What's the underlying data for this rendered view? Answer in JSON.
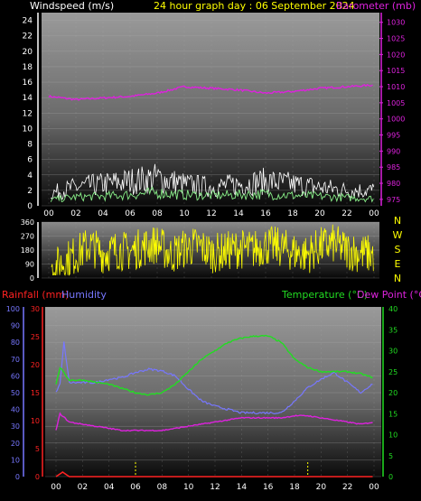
{
  "header": {
    "wind_label": "Windspeed (m/s)",
    "title": "24 hour graph day : 06 September 2024",
    "baro_label": "Barometer (mb)"
  },
  "colors": {
    "wind": "#ffffff",
    "gust": "#ffffff",
    "wind_avg": "#88ee88",
    "barometer": "#dd22dd",
    "direction": "#ffff00",
    "temperature": "#22dd22",
    "dewpoint": "#dd22dd",
    "humidity": "#7777ff",
    "rainfall": "#ff2222",
    "header_text": "#ffff00",
    "wind_axis": "#ffffff",
    "rain_axis": "#ff2222"
  },
  "chart_data": [
    {
      "type": "line",
      "name": "wind-barometer",
      "x_ticks": [
        "00",
        "02",
        "04",
        "06",
        "08",
        "10",
        "12",
        "14",
        "16",
        "18",
        "20",
        "22",
        "00"
      ],
      "y_left_ticks": [
        "0",
        "2",
        "4",
        "6",
        "8",
        "10",
        "12",
        "14",
        "16",
        "18",
        "20",
        "22",
        "24"
      ],
      "ylim_left": [
        0,
        25
      ],
      "y_right_ticks": [
        "975",
        "980",
        "985",
        "990",
        "995",
        "1000",
        "1005",
        "1010",
        "1015",
        "1020",
        "1025",
        "1030"
      ],
      "ylim_right": [
        973,
        1033
      ],
      "series": [
        {
          "axis": "right",
          "x": [
            0,
            2,
            4,
            6,
            8,
            10,
            12,
            14,
            16,
            18,
            20,
            22,
            24
          ],
          "values": [
            1007,
            1006,
            1006.5,
            1007,
            1008,
            1010,
            1009.5,
            1009,
            1008,
            1008.5,
            1009.5,
            1010,
            1010.5
          ]
        },
        {
          "axis": "left",
          "x": [
            0,
            2,
            4,
            6,
            8,
            10,
            12,
            14,
            16,
            18,
            20,
            22,
            24
          ],
          "values": [
            2,
            3,
            3.5,
            4,
            4.5,
            3.5,
            3,
            3.5,
            4,
            3.5,
            3,
            2.5,
            2.5
          ]
        },
        {
          "axis": "left",
          "x": [
            0,
            2,
            4,
            6,
            8,
            10,
            12,
            14,
            16,
            18,
            20,
            22,
            24
          ],
          "values": [
            0.8,
            1.2,
            1.3,
            1.5,
            1.8,
            1.5,
            1.4,
            1.5,
            1.6,
            1.4,
            1.3,
            1.1,
            1
          ]
        }
      ]
    },
    {
      "type": "scatter",
      "name": "wind-direction",
      "x_ticks": [
        "00",
        "02",
        "04",
        "06",
        "08",
        "10",
        "12",
        "14",
        "16",
        "18",
        "20",
        "22",
        "00"
      ],
      "y_ticks": [
        "0",
        "90",
        "180",
        "270",
        "360"
      ],
      "ylim": [
        0,
        360
      ],
      "compass": [
        "N",
        "W",
        "S",
        "E",
        "N"
      ],
      "series": [
        {
          "x": [
            0,
            1,
            2,
            3,
            4,
            5,
            6,
            7,
            8,
            9,
            10,
            11,
            12,
            13,
            14,
            15,
            16,
            17,
            18,
            19,
            20,
            21,
            22,
            23,
            24
          ],
          "values": [
            40,
            100,
            150,
            210,
            160,
            180,
            170,
            200,
            220,
            150,
            190,
            210,
            160,
            170,
            190,
            180,
            210,
            200,
            170,
            150,
            200,
            220,
            180,
            160,
            150
          ]
        }
      ]
    },
    {
      "type": "line",
      "name": "temp-humidity-rain",
      "x_ticks": [
        "00",
        "02",
        "04",
        "06",
        "08",
        "10",
        "12",
        "14",
        "16",
        "18",
        "20",
        "22",
        "00"
      ],
      "y_humidity_ticks": [
        "0",
        "10",
        "20",
        "30",
        "40",
        "50",
        "60",
        "70",
        "80",
        "90",
        "100"
      ],
      "ylim_humidity": [
        0,
        100
      ],
      "y_rain_ticks": [
        "0",
        "5",
        "10",
        "15",
        "20",
        "25",
        "30"
      ],
      "ylim_rain": [
        0,
        30
      ],
      "y_temp_ticks": [
        "0",
        "5",
        "10",
        "15",
        "20",
        "25",
        "30",
        "35",
        "40"
      ],
      "ylim_temp": [
        0,
        40
      ],
      "labels": {
        "rain": "Rainfall (mm)",
        "humidity": "Humidity",
        "temperature": "Temperature (°C)",
        "dewpoint": "Dew Point (°C)"
      },
      "series": [
        {
          "axis": "temp",
          "x": [
            0,
            0.3,
            1,
            2,
            3,
            4,
            5,
            6,
            7,
            8,
            9,
            10,
            11,
            12,
            13,
            14,
            15,
            16,
            17,
            18,
            19,
            20,
            21,
            22,
            23,
            24
          ],
          "values": [
            22,
            26,
            23,
            23,
            22.5,
            22,
            21,
            20,
            19.5,
            20,
            22,
            25,
            28,
            30,
            32,
            33,
            33.5,
            33.5,
            32,
            28,
            26,
            25,
            25,
            25,
            24.5,
            23.5
          ]
        },
        {
          "axis": "temp",
          "x": [
            0,
            0.3,
            1,
            2,
            3,
            4,
            5,
            6,
            7,
            8,
            9,
            10,
            11,
            12,
            13,
            14,
            15,
            16,
            17,
            18,
            19,
            20,
            21,
            22,
            23,
            24
          ],
          "values": [
            11,
            15,
            13,
            12.5,
            12,
            11.5,
            11,
            11,
            11,
            11,
            11.5,
            12,
            12.5,
            13,
            13.5,
            14,
            14,
            14,
            14,
            14.5,
            14.5,
            14,
            13.5,
            13,
            12.5,
            13
          ]
        },
        {
          "axis": "humidity",
          "x": [
            0,
            0.3,
            0.6,
            1,
            2,
            3,
            4,
            5,
            6,
            7,
            8,
            9,
            10,
            11,
            12,
            13,
            14,
            15,
            16,
            17,
            18,
            19,
            20,
            21,
            22,
            23,
            24
          ],
          "values": [
            50,
            55,
            80,
            56,
            56,
            56,
            58,
            59,
            62,
            64,
            63,
            60,
            52,
            45,
            42,
            40,
            38,
            38,
            38,
            38,
            45,
            53,
            58,
            62,
            56,
            50,
            56
          ]
        },
        {
          "axis": "rain",
          "x": [
            0,
            0.5,
            1,
            2,
            4,
            6,
            8,
            10,
            12,
            14,
            16,
            18,
            20,
            22,
            24
          ],
          "values": [
            0,
            0.8,
            0,
            0,
            0,
            0,
            0,
            0,
            0,
            0,
            0,
            0,
            0,
            0,
            0
          ]
        }
      ]
    }
  ]
}
